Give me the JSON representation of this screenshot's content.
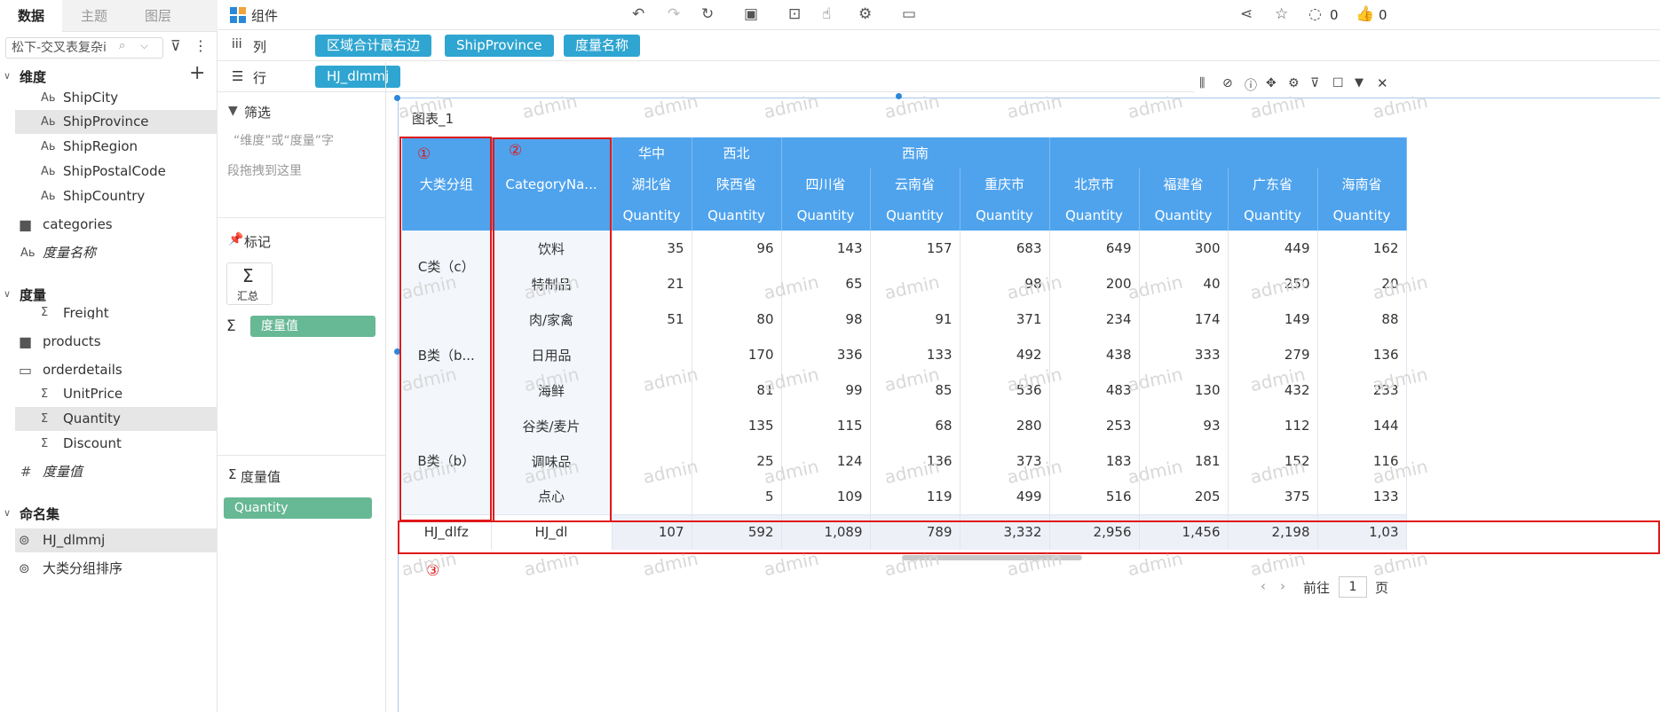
{
  "left_panel": {
    "tabs": [
      "数据",
      "主题",
      "图层"
    ],
    "search_value": "松下-交叉表复杂i",
    "dimension_section": "维度",
    "dimension_items": [
      "ShipCity",
      "ShipProvince",
      "ShipRegion",
      "ShipPostalCode",
      "ShipCountry"
    ],
    "categories_folder": "categories",
    "measure_name_field": "度量名称",
    "measure_section": "度量",
    "freight": "Freight",
    "products_folder": "products",
    "orderdetails_folder": "orderdetails",
    "measure_items": [
      "UnitPrice",
      "Quantity",
      "Discount"
    ],
    "measure_value_field": "度量值",
    "named_set_section": "命名集",
    "named_set_items": [
      "HJ_dlmmj",
      "大类分组排序"
    ]
  },
  "toolbar": {
    "component_label": "组件",
    "comment_count": "0",
    "like_count": "0"
  },
  "columns_bar": {
    "label": "列",
    "pills": [
      "区域合计最右边",
      "ShipProvince",
      "度量名称"
    ]
  },
  "rows_bar": {
    "label": "行",
    "pills": [
      "HJ_dlmmj"
    ]
  },
  "middle_panel": {
    "filter_title": "筛选",
    "filter_hint_line1": "“维度”或“度量”字",
    "filter_hint_line2": "段拖拽到这里",
    "mark_title": "标记",
    "sum_label": "汇总",
    "measure_value_pill": "度量值",
    "measure_value_title": "度量值",
    "quantity_pill": "Quantity"
  },
  "chart": {
    "title": "图表_1",
    "watermark": "admin",
    "regions": [
      "华中",
      "西北",
      "西南"
    ],
    "provinces": [
      "湖北省",
      "陕西省",
      "四川省",
      "云南省",
      "重庆市",
      "北京市",
      "福建省",
      "广东省",
      "海南省"
    ],
    "measure": "Quantity",
    "row_headers": [
      "大类分组",
      "CategoryNa..."
    ],
    "groups": [
      {
        "name": "C类（c）",
        "rows": [
          {
            "category": "饮料",
            "values": [
              "35",
              "96",
              "143",
              "157",
              "683",
              "649",
              "300",
              "449",
              "162"
            ]
          },
          {
            "category": "特制品",
            "values": [
              "21",
              "",
              "65",
              "",
              "98",
              "200",
              "40",
              "250",
              "20"
            ]
          }
        ]
      },
      {
        "name": "B类（b...",
        "rows": [
          {
            "category": "肉/家禽",
            "values": [
              "51",
              "80",
              "98",
              "91",
              "371",
              "234",
              "174",
              "149",
              "88"
            ]
          },
          {
            "category": "日用品",
            "values": [
              "",
              "170",
              "336",
              "133",
              "492",
              "438",
              "333",
              "279",
              "136"
            ]
          },
          {
            "category": "海鲜",
            "values": [
              "",
              "81",
              "99",
              "85",
              "536",
              "483",
              "130",
              "432",
              "233"
            ]
          }
        ]
      },
      {
        "name": "B类（b）",
        "rows": [
          {
            "category": "谷类/麦片",
            "values": [
              "",
              "135",
              "115",
              "68",
              "280",
              "253",
              "93",
              "112",
              "144"
            ]
          },
          {
            "category": "调味品",
            "values": [
              "",
              "25",
              "124",
              "136",
              "373",
              "183",
              "181",
              "152",
              "116"
            ]
          },
          {
            "category": "点心",
            "values": [
              "",
              "5",
              "109",
              "119",
              "499",
              "516",
              "205",
              "375",
              "133"
            ]
          }
        ]
      }
    ],
    "total_row": {
      "group": "HJ_dlfz",
      "category": "HJ_dl",
      "values": [
        "107",
        "592",
        "1,089",
        "789",
        "3,332",
        "2,956",
        "1,456",
        "2,198",
        "1,03"
      ]
    },
    "annotations": [
      "①",
      "②",
      "③"
    ],
    "pager": {
      "prev_label": "前往",
      "page": "1",
      "suffix": "页"
    }
  },
  "colors": {
    "header_blue": "#4fa3ed",
    "pill_blue": "#2fa5d1",
    "pill_green": "#67b895",
    "annotation_red": "#e01919"
  }
}
